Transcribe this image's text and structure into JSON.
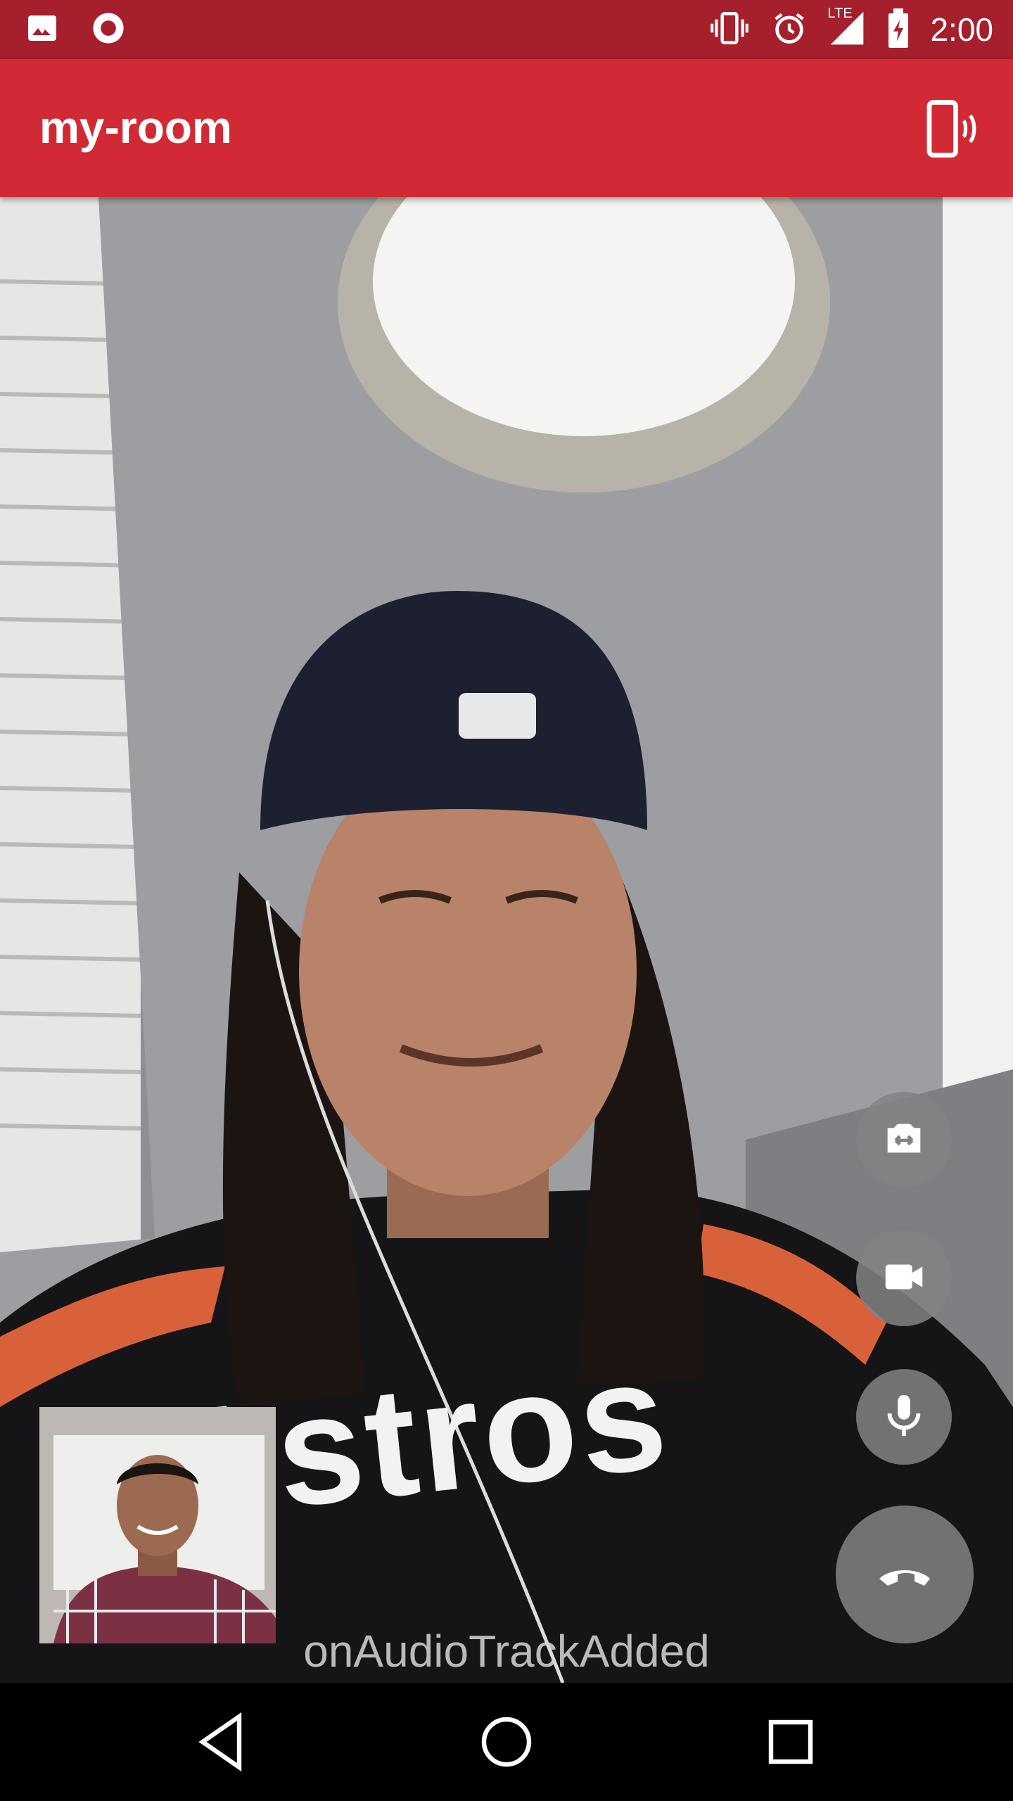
{
  "status_bar": {
    "time": "2:00",
    "network_label": "LTE",
    "icons": [
      "image-icon",
      "record-icon",
      "vibrate-icon",
      "alarm-icon",
      "signal-icon",
      "battery-icon"
    ]
  },
  "app_bar": {
    "title": "my-room",
    "action_icon": "speakerphone-icon"
  },
  "remote_video": {
    "shirt_text": "Astros"
  },
  "controls": {
    "icons": [
      "switch-camera-icon",
      "video-camera-icon",
      "microphone-icon",
      "hang-up-icon"
    ],
    "hangup_color": "#7a7a7a"
  },
  "status_message": "onAudioTrackAdded",
  "nav_bar": {
    "icons": [
      "back-icon",
      "home-icon",
      "recents-icon"
    ]
  },
  "colors": {
    "status_bar": "#a51f2c",
    "app_bar": "#d12a35"
  }
}
